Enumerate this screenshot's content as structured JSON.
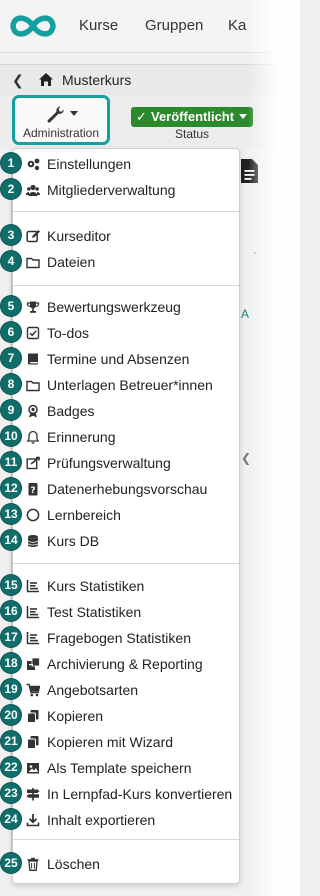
{
  "brand": {
    "accent": "#15a0a0",
    "callout_color": "#0f6e6a",
    "status_green": "#2c8a2c",
    "logo_icon": "infinity-icon"
  },
  "topnav": {
    "items": [
      "Kurse",
      "Gruppen",
      "Ka"
    ]
  },
  "breadcrumb": {
    "title": "Musterkurs",
    "icon": "home-icon"
  },
  "toolbar": {
    "admin_label": "Administration",
    "admin_icon": "wrench-icon",
    "status_value": "Veröffentlicht",
    "status_label": "Status"
  },
  "menu": {
    "items": [
      {
        "num": "1",
        "label": "Einstellungen",
        "icon": "gears-icon"
      },
      {
        "num": "2",
        "label": "Mitgliederverwaltung",
        "icon": "users-icon"
      },
      {
        "num": "3",
        "label": "Kurseditor",
        "icon": "edit-icon"
      },
      {
        "num": "4",
        "label": "Dateien",
        "icon": "folder-icon"
      },
      {
        "num": "5",
        "label": "Bewertungswerkzeug",
        "icon": "trophy-icon"
      },
      {
        "num": "6",
        "label": "To-dos",
        "icon": "checkbox-icon"
      },
      {
        "num": "7",
        "label": "Termine und Absenzen",
        "icon": "book-icon"
      },
      {
        "num": "8",
        "label": "Unterlagen Betreuer*innen",
        "icon": "folder-icon"
      },
      {
        "num": "9",
        "label": "Badges",
        "icon": "badge-icon"
      },
      {
        "num": "10",
        "label": "Erinnerung",
        "icon": "bell-icon"
      },
      {
        "num": "11",
        "label": "Prüfungsverwaltung",
        "icon": "exam-icon"
      },
      {
        "num": "12",
        "label": "Datenerhebungsvorschau",
        "icon": "lock-icon"
      },
      {
        "num": "13",
        "label": "Lernbereich",
        "icon": "circle-icon"
      },
      {
        "num": "14",
        "label": "Kurs DB",
        "icon": "database-icon"
      },
      {
        "num": "15",
        "label": "Kurs Statistiken",
        "icon": "bar-chart-icon"
      },
      {
        "num": "16",
        "label": "Test Statistiken",
        "icon": "bar-chart-icon"
      },
      {
        "num": "17",
        "label": "Fragebogen Statistiken",
        "icon": "bar-chart-icon"
      },
      {
        "num": "18",
        "label": "Archivierung & Reporting",
        "icon": "archive-icon"
      },
      {
        "num": "19",
        "label": "Angebotsarten",
        "icon": "cart-icon"
      },
      {
        "num": "20",
        "label": "Kopieren",
        "icon": "copy-icon"
      },
      {
        "num": "21",
        "label": "Kopieren mit Wizard",
        "icon": "copy-icon"
      },
      {
        "num": "22",
        "label": "Als Template speichern",
        "icon": "image-icon"
      },
      {
        "num": "23",
        "label": "In Lernpfad-Kurs konvertieren",
        "icon": "signpost-icon"
      },
      {
        "num": "24",
        "label": "Inhalt exportieren",
        "icon": "download-icon"
      },
      {
        "num": "25",
        "label": "Löschen",
        "icon": "trash-icon"
      }
    ]
  }
}
